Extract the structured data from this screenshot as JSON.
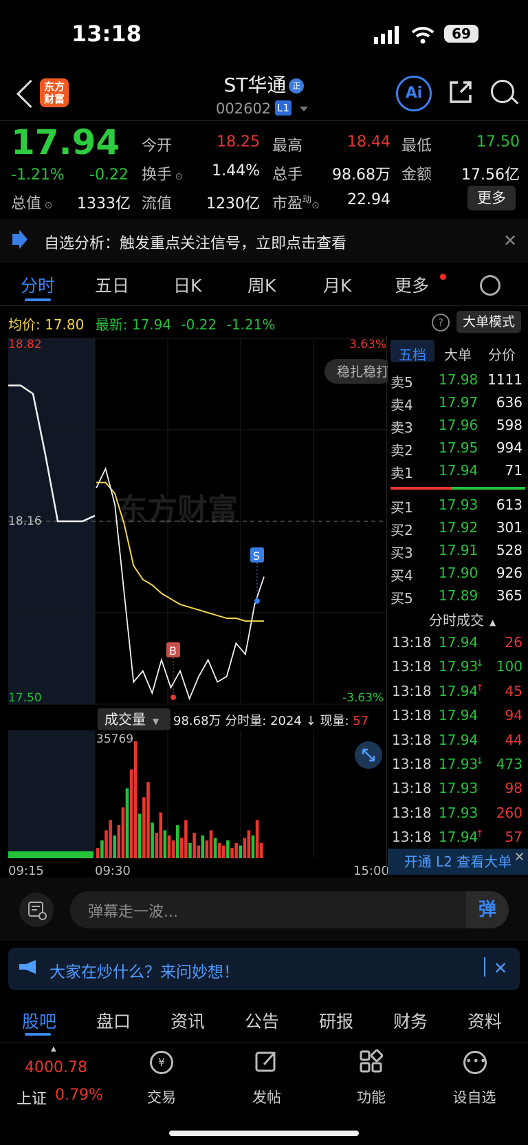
{
  "status_bar": {
    "time": "13:18",
    "battery": "69"
  },
  "header": {
    "logo_line1": "东方",
    "logo_line2": "财富",
    "title": "ST华通",
    "title_badge": "正",
    "code": "002602",
    "level": "L1",
    "ai_label": "Ai"
  },
  "quote": {
    "price": "17.94",
    "change_pct": "-1.21%",
    "change": "-0.22",
    "open_label": "今开",
    "open": "18.25",
    "high_label": "最高",
    "high": "18.44",
    "low_label": "最低",
    "low": "17.50",
    "turnover_label": "换手",
    "turnover": "1.44%",
    "volume_label": "总手",
    "volume": "98.68万",
    "amount_label": "金额",
    "amount": "17.56亿",
    "mktcap_label": "总值",
    "mktcap": "1333亿",
    "float_label": "流值",
    "float": "1230亿",
    "pe_label": "市盈",
    "pe_sup": "动",
    "pe": "22.94",
    "more": "更多"
  },
  "notice": {
    "text": "自选分析：触发重点关注信号，立即点击查看"
  },
  "tabs": [
    "分时",
    "五日",
    "日K",
    "周K",
    "月K",
    "更多"
  ],
  "chart_header": {
    "avg_label": "均价:",
    "avg": "17.80",
    "latest_label": "最新:",
    "latest": "17.94",
    "change": "-0.22",
    "change_pct": "-1.21%",
    "mode": "大单模式"
  },
  "chart_overlay": {
    "top_price": "18.82",
    "mid_price": "18.16",
    "bottom_price": "17.50",
    "top_pct": "3.63%",
    "bottom_pct": "-3.63%",
    "watermark": "东方财富",
    "tag": "稳扎稳打",
    "buy_marker": "B",
    "sell_marker": "S"
  },
  "chart_data": [
    {
      "type": "line",
      "title": "",
      "ylim": [
        17.5,
        18.82
      ],
      "x_labels": [
        "09:15",
        "09:30",
        "15:00"
      ],
      "series": [
        {
          "name": "均价",
          "color": "#f1d54a",
          "values": [
            18.3,
            18.3,
            18.26,
            18.15,
            18.0,
            17.95,
            17.93,
            17.9,
            17.88,
            17.86,
            17.85,
            17.84,
            17.83,
            17.82,
            17.81,
            17.81,
            17.8,
            17.8,
            17.8
          ]
        },
        {
          "name": "",
          "color": "#f2f2f2",
          "values": [
            18.28,
            18.35,
            18.22,
            17.9,
            17.58,
            17.62,
            17.54,
            17.66,
            17.56,
            17.62,
            17.52,
            17.6,
            17.66,
            17.58,
            17.6,
            17.72,
            17.68,
            17.86,
            17.96
          ]
        }
      ],
      "auction_values": [
        18.65,
        18.65,
        18.62,
        18.4,
        18.16,
        18.16,
        18.16,
        18.18
      ]
    },
    {
      "type": "bar",
      "title": "成交量",
      "total": "98.68万",
      "minute_label": "分时量:",
      "minute": "2024",
      "current_label": "现量:",
      "current": "57",
      "max_label": "35769",
      "values": [
        8,
        14,
        22,
        30,
        18,
        26,
        40,
        55,
        70,
        92,
        35,
        48,
        60,
        28,
        20,
        36,
        22,
        18,
        14,
        26,
        16,
        30,
        12,
        20,
        10,
        18,
        14,
        22,
        16,
        12,
        10,
        14,
        8,
        12,
        10,
        16,
        22,
        18,
        30,
        12
      ]
    }
  ],
  "order_book": {
    "tabs": [
      "五档",
      "大单",
      "分价"
    ],
    "asks": [
      {
        "label": "卖5",
        "price": "17.98",
        "vol": "1111"
      },
      {
        "label": "卖4",
        "price": "17.97",
        "vol": "636"
      },
      {
        "label": "卖3",
        "price": "17.96",
        "vol": "598"
      },
      {
        "label": "卖2",
        "price": "17.95",
        "vol": "994"
      },
      {
        "label": "卖1",
        "price": "17.94",
        "vol": "71"
      }
    ],
    "bids": [
      {
        "label": "买1",
        "price": "17.93",
        "vol": "613"
      },
      {
        "label": "买2",
        "price": "17.92",
        "vol": "301"
      },
      {
        "label": "买3",
        "price": "17.91",
        "vol": "528"
      },
      {
        "label": "买4",
        "price": "17.90",
        "vol": "926"
      },
      {
        "label": "买5",
        "price": "17.89",
        "vol": "365"
      }
    ],
    "ticks_title": "分时成交",
    "ticks": [
      {
        "time": "13:18",
        "price": "17.94",
        "arrow": "",
        "vol": "26"
      },
      {
        "time": "13:18",
        "price": "17.93",
        "arrow": "↓",
        "vol": "100"
      },
      {
        "time": "13:18",
        "price": "17.94",
        "arrow": "↑",
        "vol": "45"
      },
      {
        "time": "13:18",
        "price": "17.94",
        "arrow": "",
        "vol": "94"
      },
      {
        "time": "13:18",
        "price": "17.94",
        "arrow": "",
        "vol": "44"
      },
      {
        "time": "13:18",
        "price": "17.93",
        "arrow": "↓",
        "vol": "473"
      },
      {
        "time": "13:18",
        "price": "17.93",
        "arrow": "",
        "vol": "98"
      },
      {
        "time": "13:18",
        "price": "17.93",
        "arrow": "",
        "vol": "260"
      },
      {
        "time": "13:18",
        "price": "17.94",
        "arrow": "↑",
        "vol": "57"
      }
    ],
    "l2_banner": "开通 L2 查看大单"
  },
  "danmaku": {
    "placeholder": "弹幕走一波...",
    "send": "弹"
  },
  "ask_banner": {
    "text": "大家在炒什么？来问妙想！"
  },
  "bottom_tabs": [
    "股吧",
    "盘口",
    "资讯",
    "公告",
    "研报",
    "财务",
    "资料"
  ],
  "bottom_nav": {
    "index_value": "4000.78",
    "index_name": "上证",
    "index_pct": "0.79%",
    "items": [
      "交易",
      "发帖",
      "功能",
      "设自选"
    ]
  }
}
